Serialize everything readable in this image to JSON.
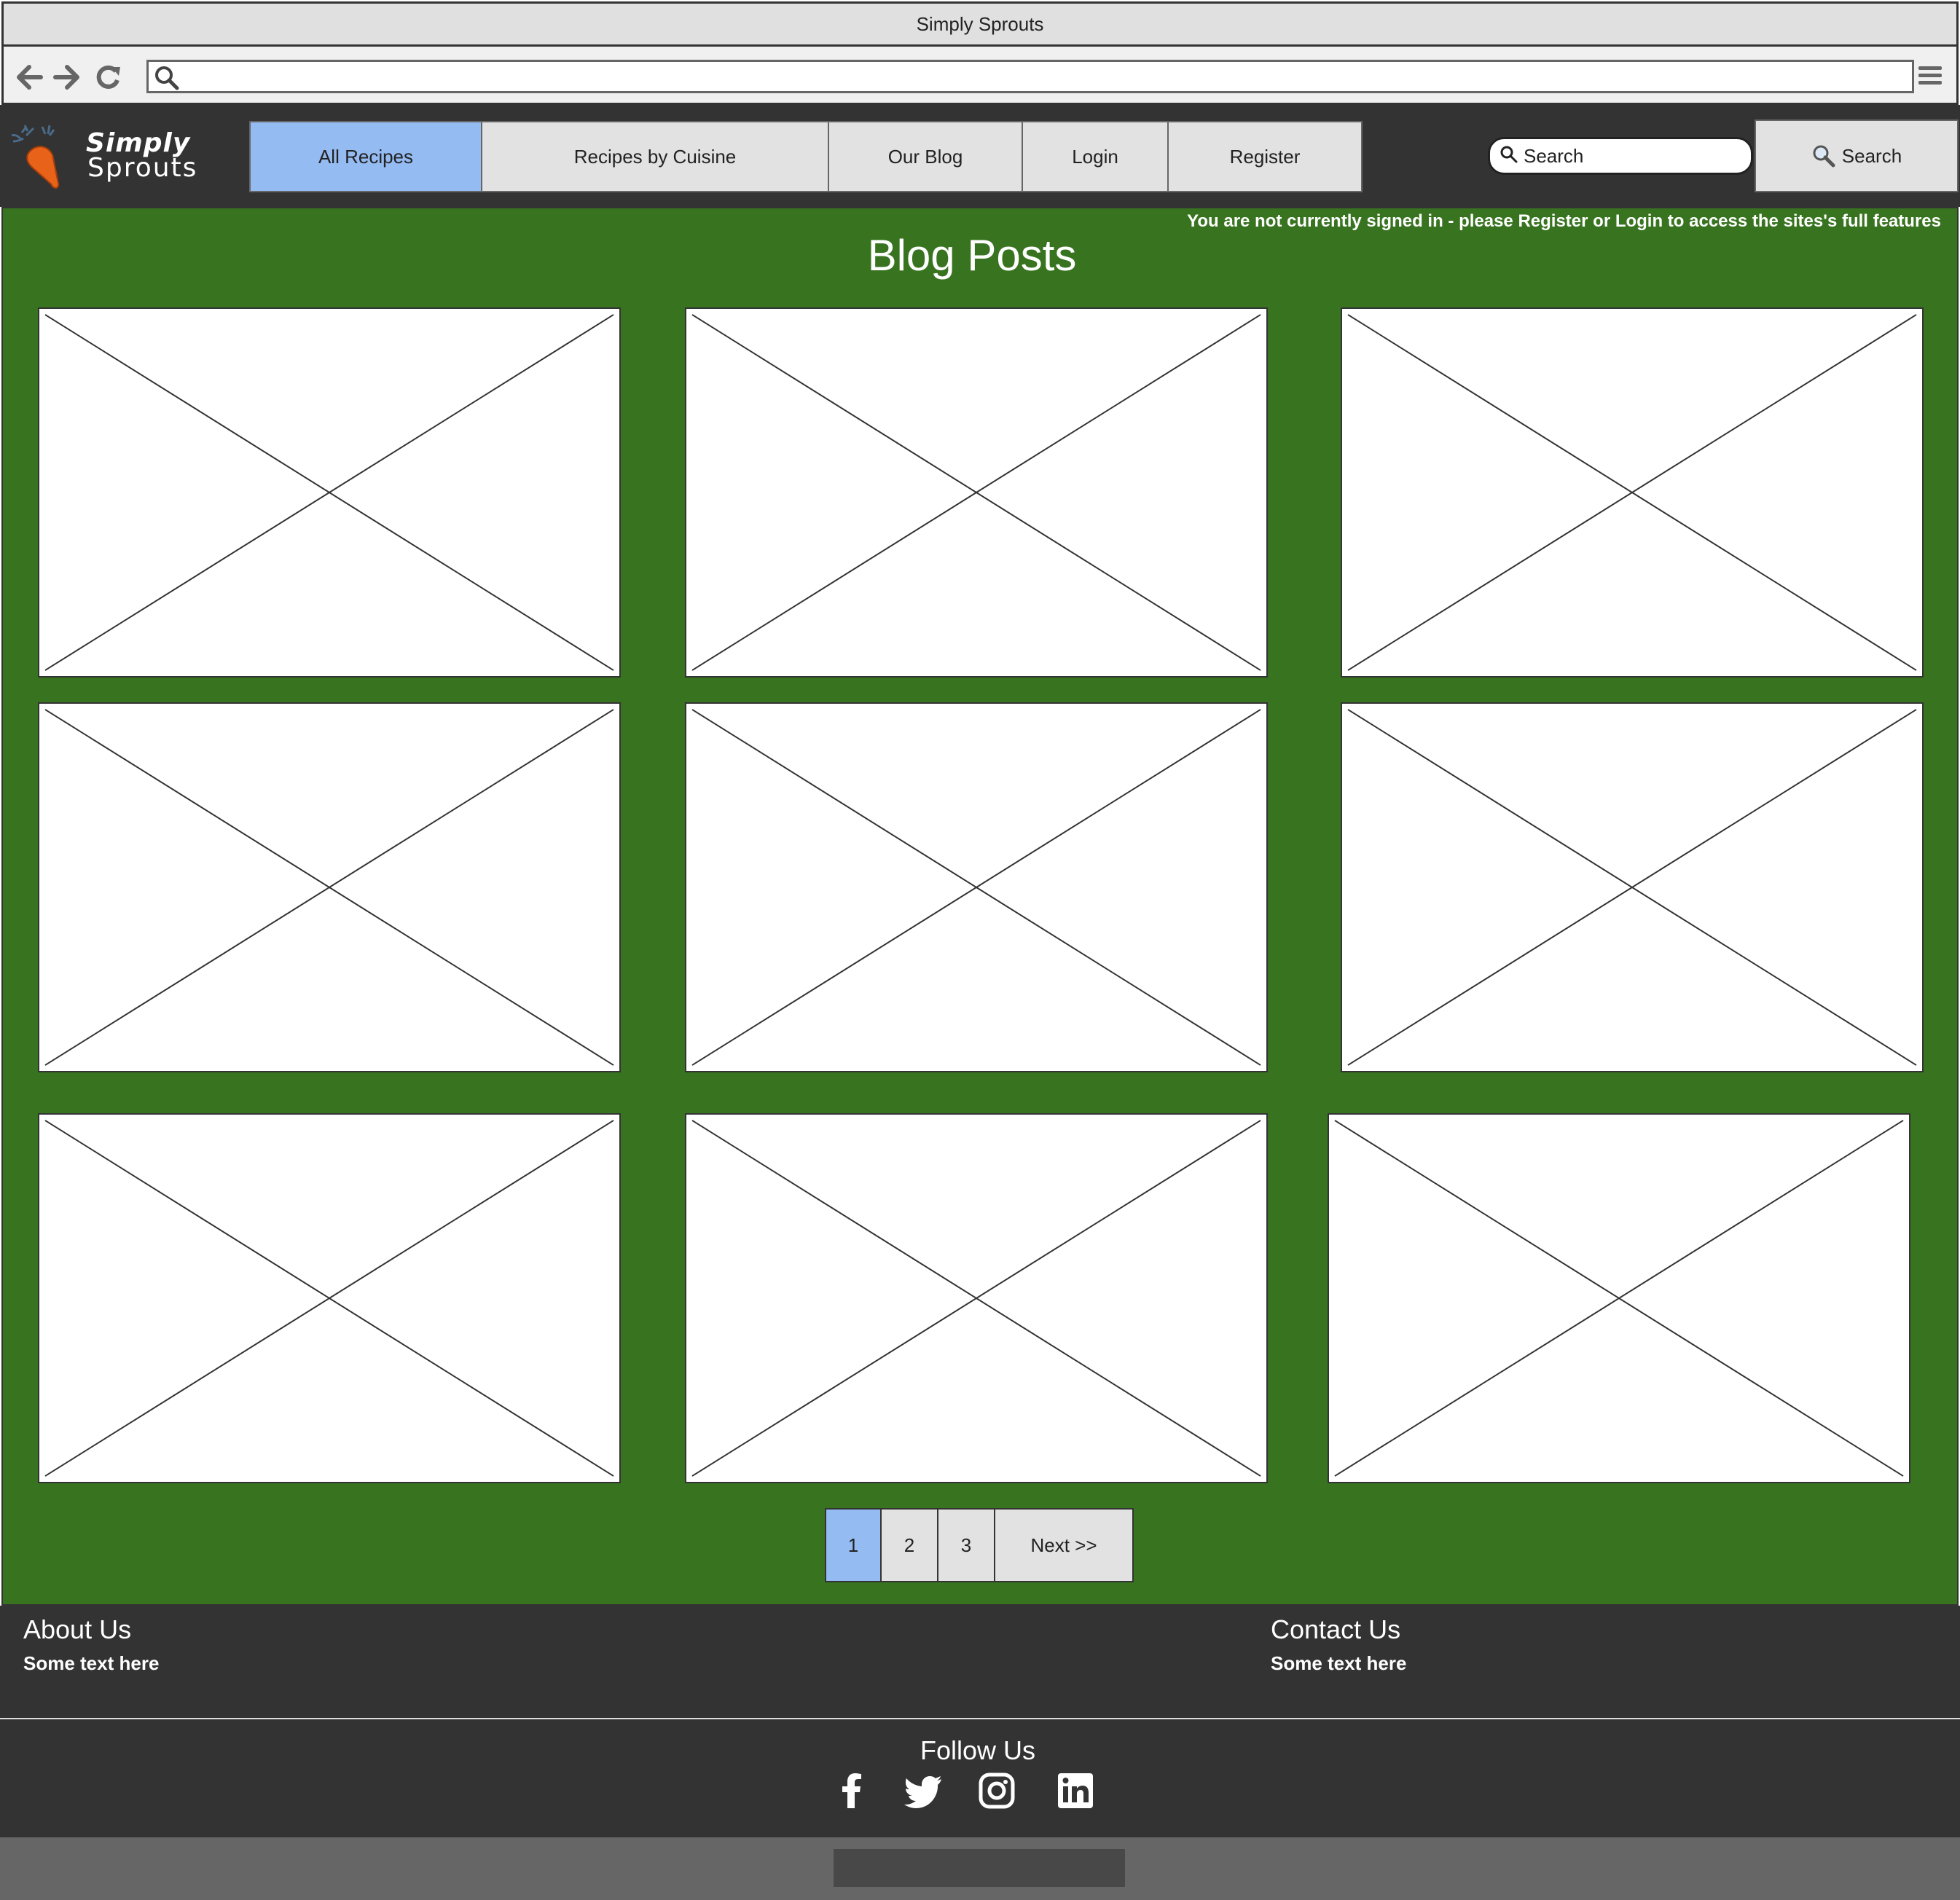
{
  "browser": {
    "window_title": "Simply Sprouts",
    "url": ""
  },
  "header": {
    "logo": {
      "line1": "Simply",
      "line2": "Sprouts"
    },
    "nav": [
      {
        "label": "All Recipes",
        "active": true
      },
      {
        "label": "Recipes by Cuisine",
        "active": false
      },
      {
        "label": "Our Blog",
        "active": false
      },
      {
        "label": "Login",
        "active": false
      },
      {
        "label": "Register",
        "active": false
      }
    ],
    "search_placeholder": "Search",
    "search_button": "Search"
  },
  "main": {
    "signin_notice": "You are not currently signed in - please Register or Login to access the sites's full features",
    "title": "Blog Posts",
    "cards_count_note": "9 image placeholders",
    "pagination": [
      {
        "label": "1",
        "active": true
      },
      {
        "label": "2",
        "active": false
      },
      {
        "label": "3",
        "active": false
      },
      {
        "label": "Next >>",
        "active": false
      }
    ]
  },
  "footer": {
    "about_title": "About Us",
    "about_text": "Some text here",
    "contact_title": "Contact Us",
    "contact_text": "Some text here",
    "follow_title": "Follow Us",
    "social": [
      "facebook-icon",
      "twitter-icon",
      "instagram-icon",
      "linkedin-icon"
    ]
  },
  "colors": {
    "main_bg": "#387420",
    "header_bg": "#333333",
    "active_tab": "#94bbf2",
    "tab_bg": "#e2e2e2",
    "bottom_bar": "#666666"
  }
}
